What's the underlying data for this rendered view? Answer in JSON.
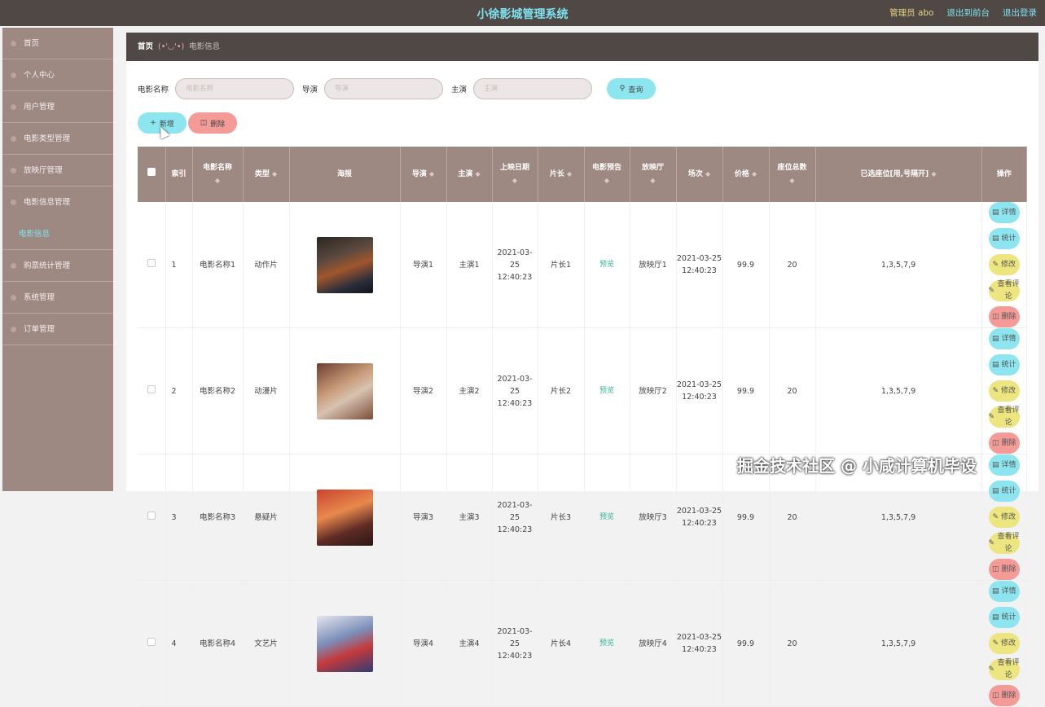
{
  "header": {
    "title": "小徐影城管理系统",
    "admin": "管理员 abo",
    "front_link": "退出到前台",
    "logout_link": "退出登录"
  },
  "sidebar": {
    "items": [
      {
        "label": "首页"
      },
      {
        "label": "个人中心"
      },
      {
        "label": "用户管理"
      },
      {
        "label": "电影类型管理"
      },
      {
        "label": "放映厅管理"
      },
      {
        "label": "电影信息管理"
      },
      {
        "label": "电影信息"
      },
      {
        "label": "购票统计管理"
      },
      {
        "label": "系统管理"
      },
      {
        "label": "订单管理"
      }
    ]
  },
  "breadcrumb": {
    "home": "首页",
    "separator": "(•'◡'•)",
    "current": "电影信息"
  },
  "search": {
    "name_label": "电影名称",
    "name_placeholder": "电影名称",
    "director_label": "导演",
    "director_placeholder": "导演",
    "actor_label": "主演",
    "actor_placeholder": "主演",
    "button": "查询"
  },
  "toolbar": {
    "add": "新增",
    "delete": "删除"
  },
  "table": {
    "headers": [
      "索引",
      "电影名称",
      "类型",
      "海报",
      "导演",
      "主演",
      "上映日期",
      "片长",
      "电影预告",
      "放映厅",
      "场次",
      "价格",
      "座位总数",
      "已选座位[用,号隔开]",
      "操作"
    ],
    "rows": [
      {
        "index": "1",
        "name": "电影名称1",
        "type": "动作片",
        "director": "导演1",
        "actor": "主演1",
        "date": "2021-03-25 12:40:23",
        "length": "片长1",
        "preview": "预览",
        "hall": "放映厅1",
        "session": "2021-03-25 12:40:23",
        "price": "99.9",
        "seats": "20",
        "selected": "1,3,5,7,9"
      },
      {
        "index": "2",
        "name": "电影名称2",
        "type": "动漫片",
        "director": "导演2",
        "actor": "主演2",
        "date": "2021-03-25 12:40:23",
        "length": "片长2",
        "preview": "预览",
        "hall": "放映厅2",
        "session": "2021-03-25 12:40:23",
        "price": "99.9",
        "seats": "20",
        "selected": "1,3,5,7,9"
      },
      {
        "index": "3",
        "name": "电影名称3",
        "type": "悬疑片",
        "director": "导演3",
        "actor": "主演3",
        "date": "2021-03-25 12:40:23",
        "length": "片长3",
        "preview": "预览",
        "hall": "放映厅3",
        "session": "2021-03-25 12:40:23",
        "price": "99.9",
        "seats": "20",
        "selected": "1,3,5,7,9"
      },
      {
        "index": "4",
        "name": "电影名称4",
        "type": "文艺片",
        "director": "导演4",
        "actor": "主演4",
        "date": "2021-03-25 12:40:23",
        "length": "片长4",
        "preview": "预览",
        "hall": "放映厅4",
        "session": "2021-03-25 12:40:23",
        "price": "99.9",
        "seats": "20",
        "selected": "1,3,5,7,9"
      }
    ],
    "ops": {
      "detail": "详情",
      "stat": "统计",
      "edit": "修改",
      "comment": "查看评论",
      "remove": "删除"
    }
  },
  "watermark": "掘金技术社区 @ 小咸计算机毕设",
  "colors": {
    "topbar": "#4f4845",
    "sidebar": "#9e8882",
    "accent_cyan": "#8de5ef",
    "accent_yellow": "#ede57f",
    "accent_red": "#f49b98"
  }
}
